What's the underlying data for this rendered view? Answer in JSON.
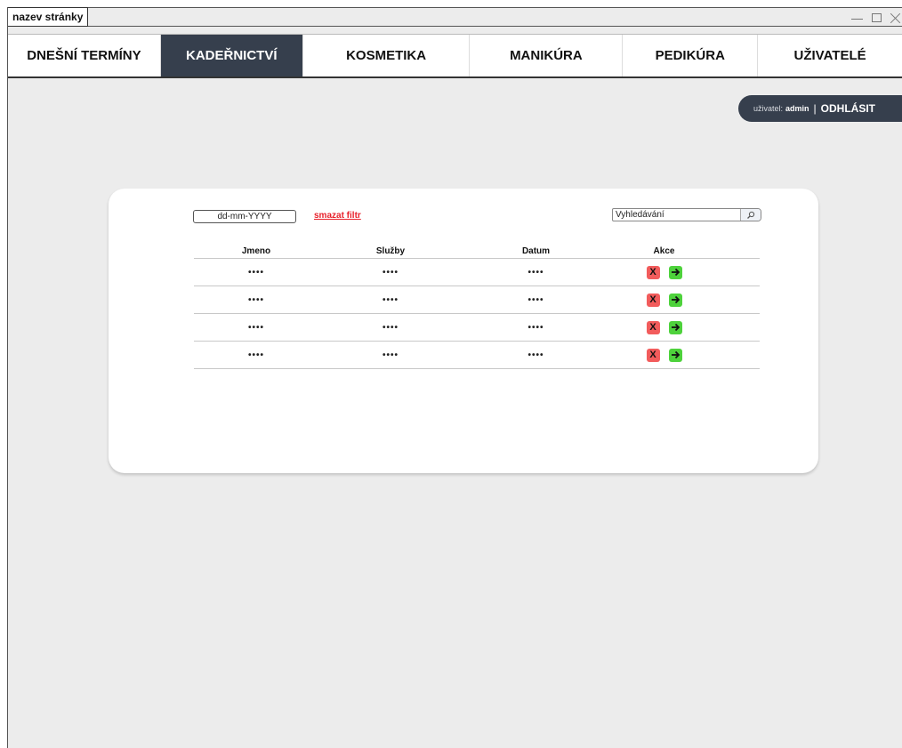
{
  "window": {
    "title": "nazev stránky"
  },
  "nav": {
    "tabs": [
      {
        "label": "DNEŠNÍ TERMÍNY",
        "active": false
      },
      {
        "label": "KADEŘNICTVÍ",
        "active": true
      },
      {
        "label": "KOSMETIKA",
        "active": false
      },
      {
        "label": "MANIKÚRA",
        "active": false
      },
      {
        "label": "PEDIKÚRA",
        "active": false
      },
      {
        "label": "UŽIVATELÉ",
        "active": false
      }
    ]
  },
  "user": {
    "prefix": "uživatel:",
    "name": "admin",
    "separator": "|",
    "logout_label": "ODHLÁSIT"
  },
  "filter": {
    "date_value": "dd-mm-YYYY",
    "clear_label": "smazat filtr",
    "search_placeholder": "Vyhledávání"
  },
  "table": {
    "headers": {
      "name": "Jmeno",
      "service": "Služby",
      "date": "Datum",
      "actions": "Akce"
    },
    "rows": [
      {
        "name": "••••",
        "service": "••••",
        "date": "••••"
      },
      {
        "name": "••••",
        "service": "••••",
        "date": "••••"
      },
      {
        "name": "••••",
        "service": "••••",
        "date": "••••"
      },
      {
        "name": "••••",
        "service": "••••",
        "date": "••••"
      }
    ],
    "delete_label": "X"
  },
  "icons": {
    "search": "search-icon",
    "delete": "delete-icon",
    "go": "arrow-right-icon",
    "minimize": "minimize-icon",
    "maximize": "maximize-icon",
    "close": "close-icon"
  },
  "colors": {
    "nav_active_bg": "#363f4d",
    "delete_bg": "#f25c5c",
    "go_bg": "#4ed23c",
    "clear_filter": "#e8212b",
    "page_bg": "#ececec"
  }
}
